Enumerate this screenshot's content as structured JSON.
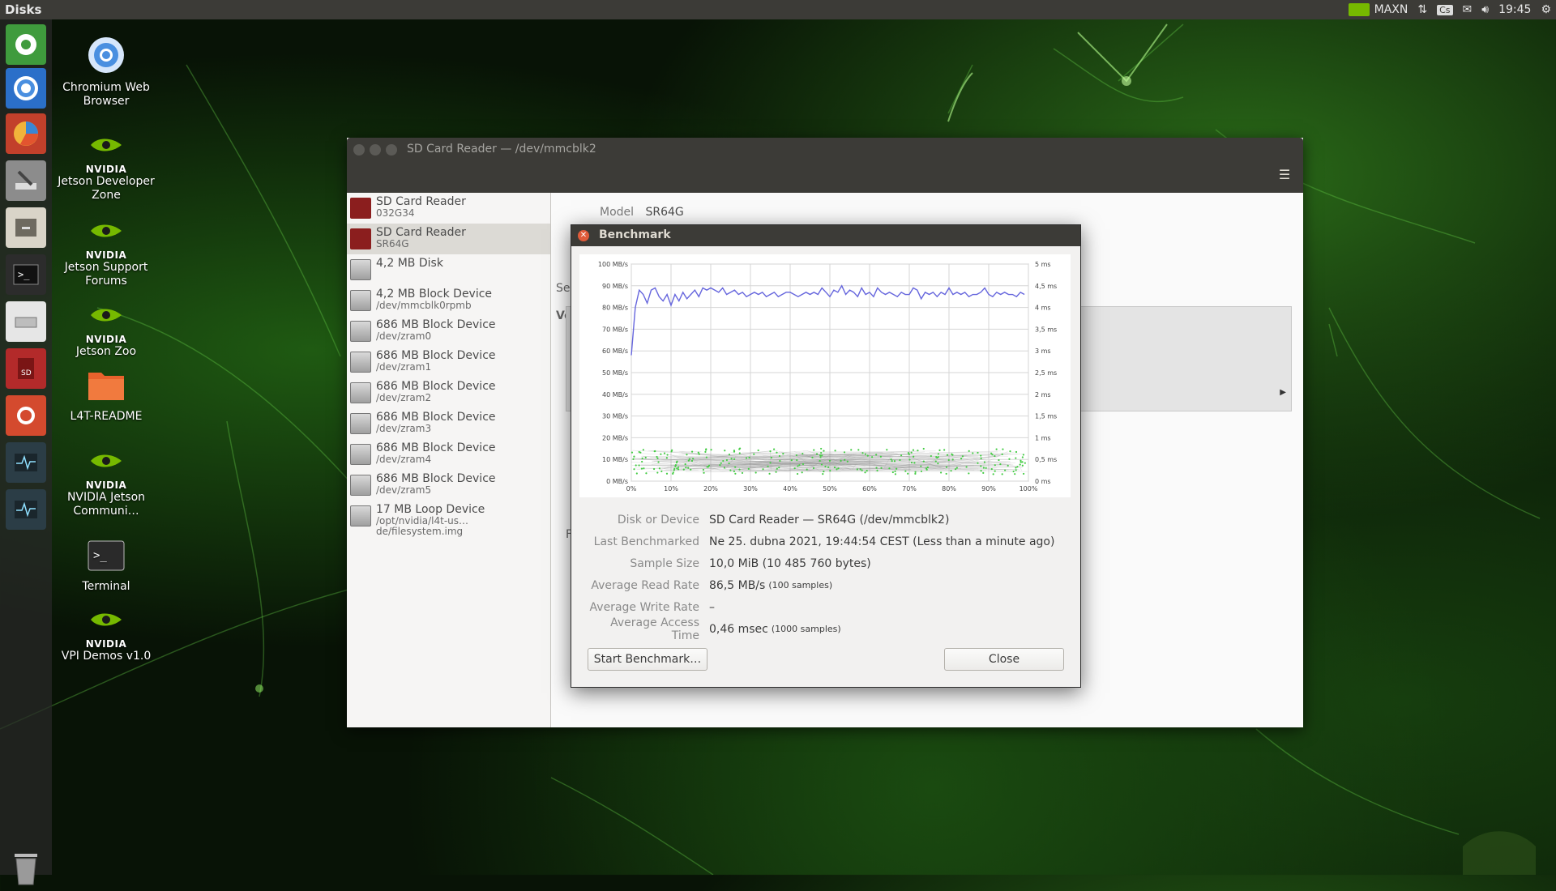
{
  "top_panel": {
    "app_title": "Disks",
    "power_mode": "MAXN",
    "keyboard_layout": "Cs",
    "clock": "19:45"
  },
  "launcher": {
    "items": [
      "files-home-icon",
      "chromium-icon",
      "charts-app-icon",
      "system-tools-icon",
      "file-cabinet-icon",
      "terminal-icon",
      "drive-icon",
      "sd-card-icon",
      "settings-tools-icon",
      "system-monitor-icon",
      "system-monitor-icon-2"
    ]
  },
  "desktop": {
    "icons": [
      {
        "label": "Chromium Web Browser"
      },
      {
        "label": "Jetson Developer Zone",
        "brand": "NVIDIA"
      },
      {
        "label": "Jetson Support Forums",
        "brand": "NVIDIA"
      },
      {
        "label": "Jetson Zoo",
        "brand": "NVIDIA"
      },
      {
        "label": "L4T-README"
      },
      {
        "label": "NVIDIA Jetson Communi…",
        "brand": "NVIDIA"
      },
      {
        "label": "Terminal"
      },
      {
        "label": "VPI Demos v1.0",
        "brand": "NVIDIA"
      }
    ]
  },
  "main_window": {
    "title": "SD Card Reader — /dev/mmcblk2",
    "menu_icon": "hamburger-menu-icon",
    "devices": [
      {
        "name": "SD Card Reader",
        "sub": "032G34",
        "icon": "sd-card-icon"
      },
      {
        "name": "SD Card Reader",
        "sub": "SR64G",
        "icon": "sd-card-icon",
        "selected": true
      },
      {
        "name": "4,2 MB Disk",
        "sub": "",
        "icon": "drive-icon"
      },
      {
        "name": "4,2 MB Block Device",
        "sub": "/dev/mmcblk0rpmb",
        "icon": "drive-icon"
      },
      {
        "name": "686 MB Block Device",
        "sub": "/dev/zram0",
        "icon": "drive-icon"
      },
      {
        "name": "686 MB Block Device",
        "sub": "/dev/zram1",
        "icon": "drive-icon"
      },
      {
        "name": "686 MB Block Device",
        "sub": "/dev/zram2",
        "icon": "drive-icon"
      },
      {
        "name": "686 MB Block Device",
        "sub": "/dev/zram3",
        "icon": "drive-icon"
      },
      {
        "name": "686 MB Block Device",
        "sub": "/dev/zram4",
        "icon": "drive-icon"
      },
      {
        "name": "686 MB Block Device",
        "sub": "/dev/zram5",
        "icon": "drive-icon"
      },
      {
        "name": "17 MB Loop Device",
        "sub": "/opt/nvidia/l4t-us…de/filesystem.img",
        "icon": "drive-icon"
      }
    ],
    "model_label": "Model",
    "model_value": "SR64G",
    "partial_labels": [
      "Se",
      "Vo",
      "F"
    ]
  },
  "benchmark": {
    "title": "Benchmark",
    "details": [
      {
        "label": "Disk or Device",
        "value": "SD Card Reader — SR64G (/dev/mmcblk2)",
        "note": ""
      },
      {
        "label": "Last Benchmarked",
        "value": "Ne 25. dubna 2021, 19:44:54 CEST (Less than a minute ago)",
        "note": ""
      },
      {
        "label": "Sample Size",
        "value": "10,0 MiB (10 485 760 bytes)",
        "note": ""
      },
      {
        "label": "Average Read Rate",
        "value": "86,5 MB/s",
        "note": "(100 samples)"
      },
      {
        "label": "Average Write Rate",
        "value": "–",
        "note": ""
      },
      {
        "label": "Average Access Time",
        "value": "0,46 msec",
        "note": "(1000 samples)"
      }
    ],
    "start_button": "Start Benchmark…",
    "close_button": "Close"
  },
  "chart_data": {
    "type": "line",
    "title": "",
    "x_ticks": [
      "0%",
      "10%",
      "20%",
      "30%",
      "40%",
      "50%",
      "60%",
      "70%",
      "80%",
      "90%",
      "100%"
    ],
    "y_left_ticks": [
      "0 MB/s",
      "10 MB/s",
      "20 MB/s",
      "30 MB/s",
      "40 MB/s",
      "50 MB/s",
      "60 MB/s",
      "70 MB/s",
      "80 MB/s",
      "90 MB/s",
      "100 MB/s"
    ],
    "y_right_ticks": [
      "0 ms",
      "0,5 ms",
      "1 ms",
      "1,5 ms",
      "2 ms",
      "2,5 ms",
      "3 ms",
      "3,5 ms",
      "4 ms",
      "4,5 ms",
      "5 ms"
    ],
    "xlim": [
      0,
      100
    ],
    "ylim_left": [
      0,
      100
    ],
    "ylim_right": [
      0,
      5
    ],
    "grid": true,
    "read_rate_color": "#6666dd",
    "access_time_color": "#44cc44",
    "read_rate_series": {
      "x": [
        0,
        1,
        2,
        3,
        4,
        5,
        6,
        7,
        8,
        9,
        10,
        11,
        12,
        13,
        14,
        15,
        16,
        17,
        18,
        19,
        20,
        21,
        22,
        23,
        24,
        25,
        26,
        27,
        28,
        29,
        30,
        31,
        32,
        33,
        34,
        35,
        36,
        37,
        38,
        39,
        40,
        41,
        42,
        43,
        44,
        45,
        46,
        47,
        48,
        49,
        50,
        51,
        52,
        53,
        54,
        55,
        56,
        57,
        58,
        59,
        60,
        61,
        62,
        63,
        64,
        65,
        66,
        67,
        68,
        69,
        70,
        71,
        72,
        73,
        74,
        75,
        76,
        77,
        78,
        79,
        80,
        81,
        82,
        83,
        84,
        85,
        86,
        87,
        88,
        89,
        90,
        91,
        92,
        93,
        94,
        95,
        96,
        97,
        98,
        99
      ],
      "values": [
        58,
        80,
        88,
        86,
        82,
        88,
        89,
        85,
        83,
        86,
        81,
        86,
        83,
        87,
        84,
        86,
        88,
        85,
        89,
        88,
        89,
        88,
        87,
        89,
        86,
        87,
        88,
        86,
        87,
        85,
        86,
        87,
        86,
        87,
        85,
        86,
        87,
        85,
        86,
        87,
        87,
        86,
        85,
        86,
        87,
        86,
        87,
        86,
        89,
        87,
        85,
        88,
        87,
        90,
        86,
        88,
        87,
        85,
        89,
        86,
        87,
        85,
        89,
        87,
        86,
        87,
        86,
        85,
        87,
        86,
        86,
        89,
        88,
        84,
        87,
        86,
        87,
        85,
        87,
        86,
        89,
        86,
        87,
        86,
        87,
        85,
        86,
        86,
        87,
        89,
        86,
        85,
        87,
        86,
        87,
        86,
        86,
        85,
        87,
        86
      ]
    },
    "access_time_summary_ms": 0.46,
    "access_time_samples": 1000
  }
}
